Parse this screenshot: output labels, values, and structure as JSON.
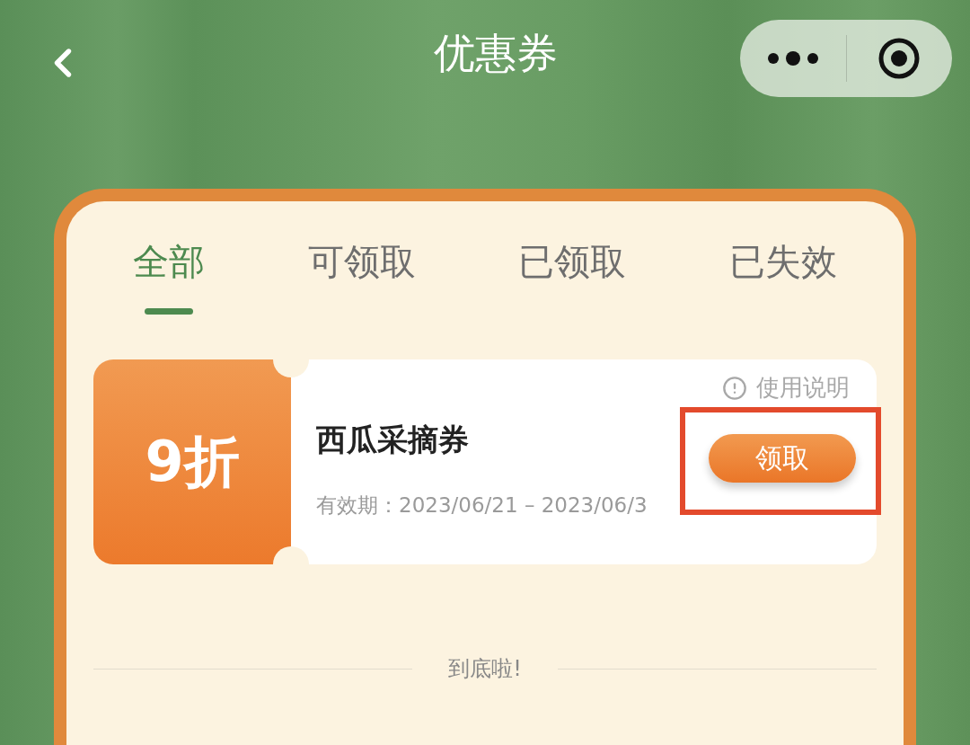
{
  "header": {
    "title": "优惠券"
  },
  "tabs": [
    {
      "label": "全部",
      "selected": true
    },
    {
      "label": "可领取",
      "selected": false
    },
    {
      "label": "已领取",
      "selected": false
    },
    {
      "label": "已失效",
      "selected": false
    }
  ],
  "coupons": [
    {
      "discount": "9折",
      "name": "西瓜采摘券",
      "info_link": "使用说明",
      "validity": "有效期：2023/06/21 – 2023/06/3",
      "button": "领取",
      "highlighted": true
    }
  ],
  "footer": "到底啦!"
}
